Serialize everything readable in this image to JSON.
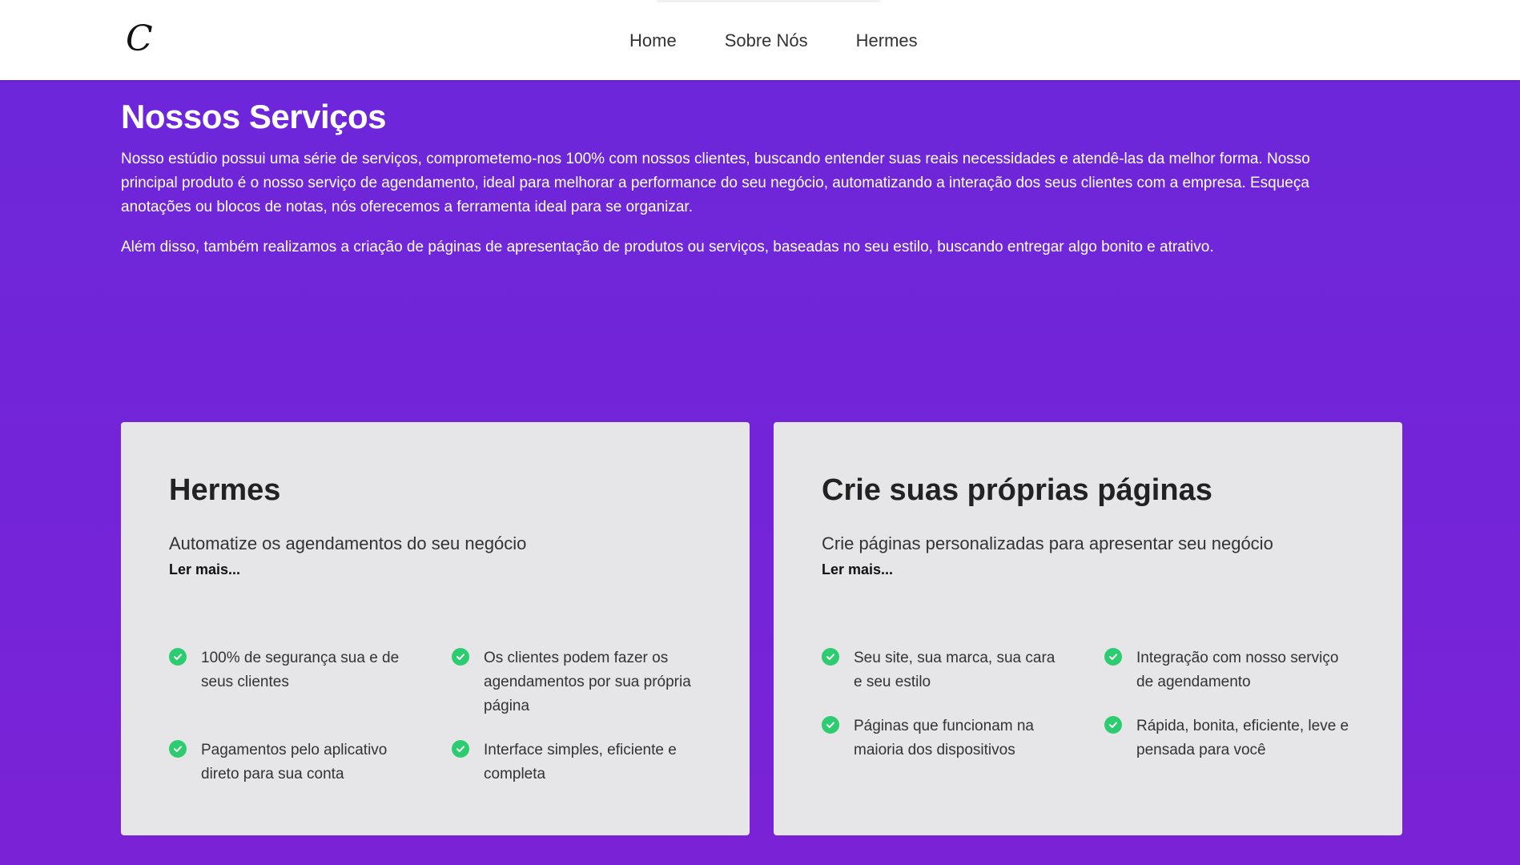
{
  "nav": {
    "logo_glyph": "C",
    "links": [
      "Home",
      "Sobre Nós",
      "Hermes"
    ]
  },
  "hero": {
    "title": "Nossos Serviços",
    "paragraph1": "Nosso estúdio possui uma série de serviços, comprometemo-nos 100% com nossos clientes, buscando entender suas reais necessidades e atendê-las da melhor forma. Nosso principal produto é o nosso serviço de agendamento, ideal para melhorar a performance do seu negócio, automatizando a interação dos seus clientes com a empresa. Esqueça anotações ou blocos de notas, nós oferecemos a ferramenta ideal para se organizar.",
    "paragraph2": "Além disso, também realizamos a criação de páginas de apresentação de produtos ou serviços, baseadas no seu estilo, buscando entregar algo bonito e atrativo."
  },
  "cards": [
    {
      "title": "Hermes",
      "subtitle": "Automatize os agendamentos do seu negócio",
      "more": "Ler mais...",
      "features": [
        "100% de segurança sua e de seus clientes",
        "Os clientes podem fazer os agendamentos por sua própria página",
        "Pagamentos pelo aplicativo direto para sua conta",
        "Interface simples, eficiente e completa"
      ]
    },
    {
      "title": "Crie suas próprias páginas",
      "subtitle": "Crie páginas personalizadas para apresentar seu negócio",
      "more": "Ler mais...",
      "features": [
        "Seu site, sua marca, sua cara e seu estilo",
        "Integração com nosso serviço de agendamento",
        "Páginas que funcionam na maioria dos dispositivos",
        "Rápida, bonita, eficiente, leve e pensada para você"
      ]
    }
  ],
  "colors": {
    "background": "#6c27da",
    "card": "#e6e6e9",
    "check": "#2ecc71"
  }
}
